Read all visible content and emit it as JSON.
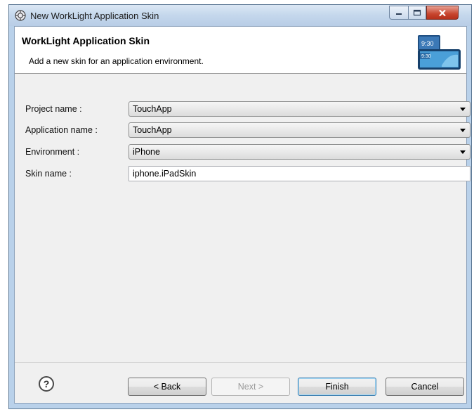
{
  "window": {
    "title": "New WorkLight Application Skin"
  },
  "header": {
    "title": "WorkLight Application Skin",
    "description": "Add a new skin for an application environment.",
    "graphic_time_top": "9:30",
    "graphic_time_bottom": "9:30"
  },
  "form": {
    "project_label": "Project name :",
    "project_value": "TouchApp",
    "application_label": "Application name :",
    "application_value": "TouchApp",
    "environment_label": "Environment :",
    "environment_value": "iPhone",
    "skin_label": "Skin name :",
    "skin_value": "iphone.iPadSkin"
  },
  "buttons": {
    "help": "?",
    "back": "< Back",
    "next": "Next >",
    "finish": "Finish",
    "cancel": "Cancel"
  }
}
